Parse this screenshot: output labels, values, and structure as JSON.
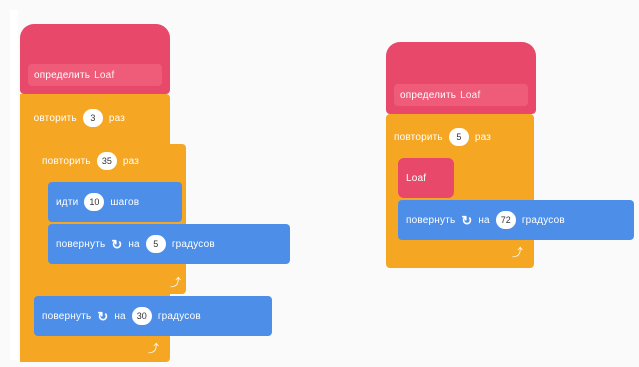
{
  "left_script": {
    "define_label": "определить",
    "define_name": "Loaf",
    "repeat_outer_label": "повторить",
    "repeat_outer_count": "3",
    "repeat_outer_suffix": "раз",
    "repeat_inner_label": "повторить",
    "repeat_inner_count": "35",
    "repeat_inner_suffix": "раз",
    "move_label": "идти",
    "move_value": "10",
    "move_suffix": "шагов",
    "turn1_label": "повернуть",
    "turn1_icon": "rotate-cw-icon",
    "turn1_mid": "на",
    "turn1_value": "5",
    "turn1_suffix": "градусов",
    "turn2_label": "повернуть",
    "turn2_icon": "rotate-cw-icon",
    "turn2_mid": "на",
    "turn2_value": "30",
    "turn2_suffix": "градусов",
    "loop_icon": "loop-arrow-icon"
  },
  "right_script": {
    "define_label": "определить",
    "define_name": "Loaf",
    "repeat_label": "повторить",
    "repeat_count": "5",
    "repeat_suffix": "раз",
    "call_label": "Loaf",
    "turn_label": "повернуть",
    "turn_icon": "rotate-cw-icon",
    "turn_mid": "на",
    "turn_value": "72",
    "turn_suffix": "градусов",
    "loop_icon": "loop-arrow-icon"
  },
  "colors": {
    "define": "#e8496b",
    "control": "#f5a623",
    "motion": "#4c8ee8",
    "background": "#fafafa"
  }
}
